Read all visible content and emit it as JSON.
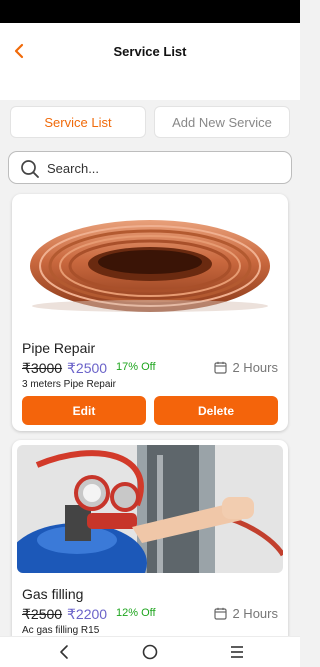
{
  "header": {
    "title": "Service List",
    "back_icon": "chevron-left-icon",
    "accent": "#f06a0a"
  },
  "tabs": [
    {
      "label": "Service List",
      "active": true
    },
    {
      "label": "Add New Service",
      "active": false
    }
  ],
  "search": {
    "placeholder": "Search...",
    "value": "",
    "icon": "search-icon"
  },
  "services": [
    {
      "title": "Pipe Repair",
      "old_price": "₹3000",
      "new_price": "₹2500",
      "discount": "17% Off",
      "duration": "2 Hours",
      "description": "3 meters Pipe Repair",
      "edit_label": "Edit",
      "delete_label": "Delete",
      "image": "copper-pipe-coil"
    },
    {
      "title": "Gas filling",
      "old_price": "₹2500",
      "new_price": "₹2200",
      "discount": "12% Off",
      "duration": "2 Hours",
      "description": "Ac gas filling R15",
      "image": "gas-cylinder-gauge"
    }
  ],
  "colors": {
    "button": "#f4640b",
    "new_price": "#6b63c9",
    "discount": "#1ea51e"
  },
  "system_nav": {
    "icons": [
      "back-icon",
      "home-icon",
      "menu-icon"
    ]
  }
}
